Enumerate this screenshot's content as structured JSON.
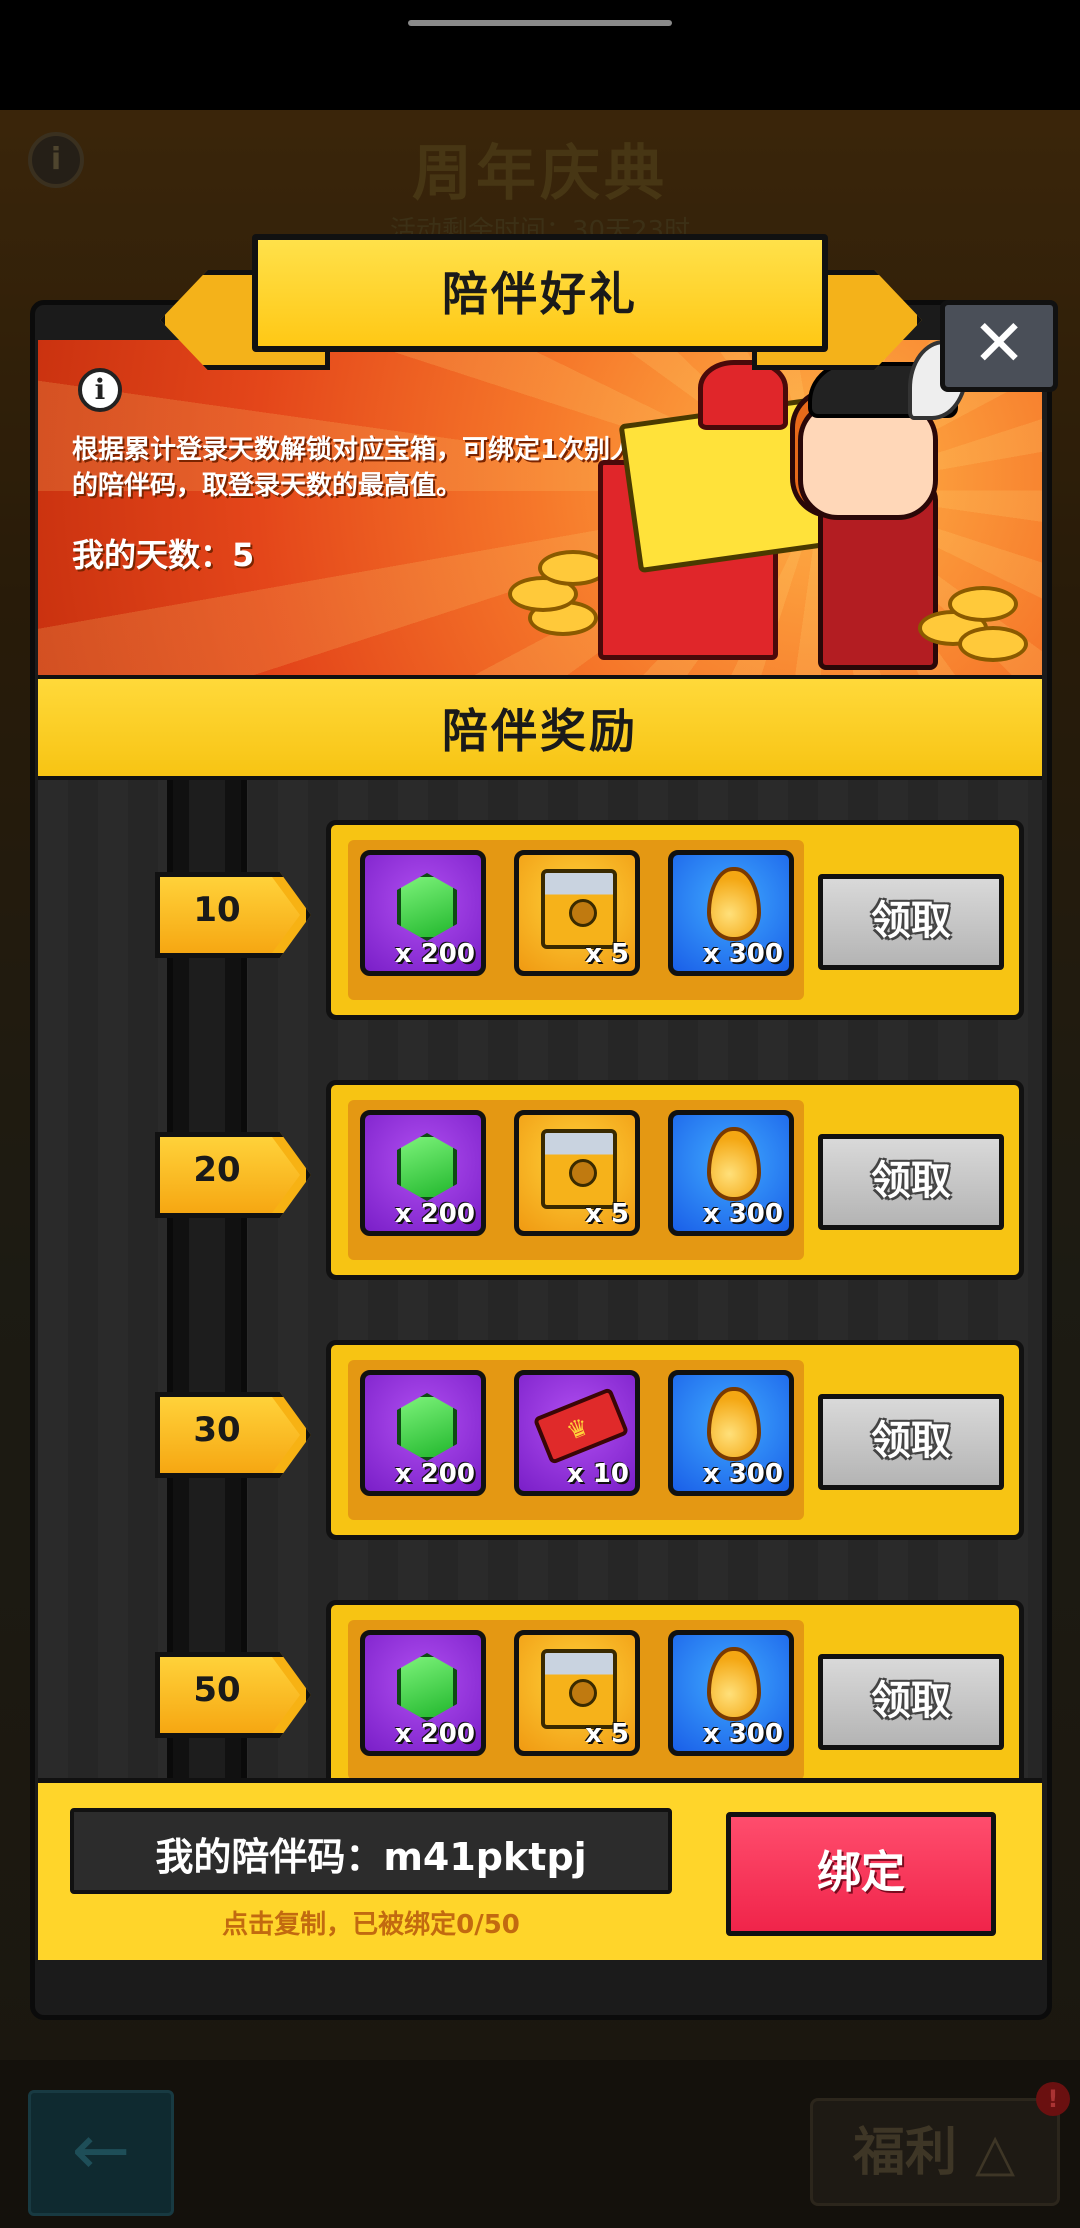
{
  "background": {
    "title": "周年庆典",
    "subtitle": "活动剩余时间：30天23时",
    "info_icon": "i",
    "back_icon": "arrow-left",
    "welfare_label": "福利",
    "badge": "!"
  },
  "dialog": {
    "title": "陪伴好礼",
    "close_icon": "✕",
    "info_icon": "i",
    "description": "根据累计登录天数解锁对应宝箱，可绑定1次别人的陪伴码，取登录天数的最高值。",
    "my_days": "我的天数：5",
    "section_title": "陪伴奖励",
    "rewards": [
      {
        "day": "10",
        "items": [
          {
            "icon": "green-gem-icon",
            "count": "x 200"
          },
          {
            "icon": "treasure-chest-icon",
            "count": "x 5"
          },
          {
            "icon": "golden-drop-icon",
            "count": "x 300"
          }
        ],
        "claim_label": "领取"
      },
      {
        "day": "20",
        "items": [
          {
            "icon": "green-gem-icon",
            "count": "x 200"
          },
          {
            "icon": "treasure-chest-icon",
            "count": "x 5"
          },
          {
            "icon": "golden-drop-icon",
            "count": "x 300"
          }
        ],
        "claim_label": "领取"
      },
      {
        "day": "30",
        "items": [
          {
            "icon": "green-gem-icon",
            "count": "x 200"
          },
          {
            "icon": "red-ticket-icon",
            "count": "x 10"
          },
          {
            "icon": "golden-drop-icon",
            "count": "x 300"
          }
        ],
        "claim_label": "领取"
      },
      {
        "day": "50",
        "items": [
          {
            "icon": "green-gem-icon",
            "count": "x 200"
          },
          {
            "icon": "treasure-chest-icon",
            "count": "x 5"
          },
          {
            "icon": "golden-drop-icon",
            "count": "x 300"
          }
        ],
        "claim_label": "领取"
      }
    ],
    "companion_code": "我的陪伴码：m41pktpj",
    "copy_hint": "点击复制，已被绑定0/50",
    "bind_label": "绑定"
  },
  "colors": {
    "accent_yellow": "#f7c413",
    "banner_orange": "#e4461a",
    "bind_red": "#f0244a",
    "claim_gray": "#b4b4b4"
  }
}
